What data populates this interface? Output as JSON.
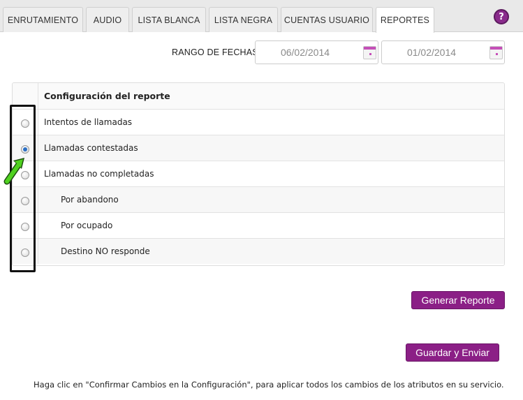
{
  "tabs": [
    {
      "label": "ENRUTAMIENTO",
      "active": false
    },
    {
      "label": "AUDIO",
      "active": false
    },
    {
      "label": "LISTA BLANCA",
      "active": false
    },
    {
      "label": "LISTA NEGRA",
      "active": false
    },
    {
      "label": "CUENTAS USUARIO",
      "active": false
    },
    {
      "label": "REPORTES",
      "active": true
    }
  ],
  "help_label": "?",
  "date_range": {
    "label": "RANGO DE FECHAS:",
    "start": "06/02/2014",
    "end": "01/02/2014"
  },
  "report_table": {
    "header": "Configuración del reporte",
    "options": [
      {
        "label": "Intentos de llamadas",
        "checked": false,
        "indent": false
      },
      {
        "label": "Llamadas contestadas",
        "checked": true,
        "indent": false
      },
      {
        "label": "Llamadas no completadas",
        "checked": false,
        "indent": false
      },
      {
        "label": "Por abandono",
        "checked": false,
        "indent": true
      },
      {
        "label": "Por ocupado",
        "checked": false,
        "indent": true
      },
      {
        "label": "Destino NO responde",
        "checked": false,
        "indent": true
      }
    ]
  },
  "buttons": {
    "generate": "Generar Reporte",
    "save_send": "Guardar y Enviar"
  },
  "footer_note": "Haga clic en \"Confirmar Cambios en la Configuración\", para aplicar todos los cambios de los atributos en su servicio.",
  "colors": {
    "accent": "#8b1f86",
    "highlight_arrow": "#4fd11f"
  }
}
